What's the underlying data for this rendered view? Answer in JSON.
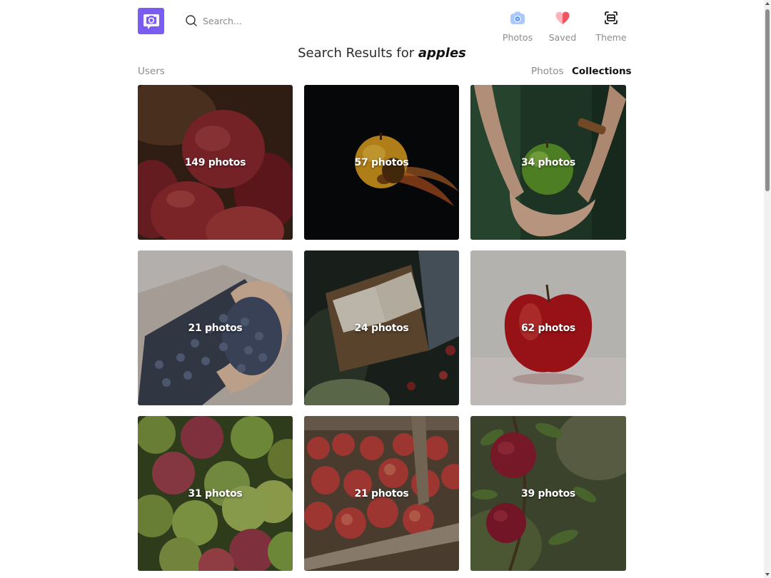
{
  "header": {
    "search_placeholder": "Search...",
    "nav": [
      {
        "label": "Photos",
        "icon": "camera-icon"
      },
      {
        "label": "Saved",
        "icon": "heart-icon"
      },
      {
        "label": "Theme",
        "icon": "theme-icon"
      }
    ]
  },
  "results": {
    "prefix": "Search Results for",
    "query": "apples"
  },
  "tabs": {
    "users": "Users",
    "photos": "Photos",
    "collections": "Collections",
    "active": "Collections"
  },
  "collections": [
    {
      "count": "149 photos",
      "subject": "red apples in basket"
    },
    {
      "count": "57 photos",
      "subject": "burning apple on dark background"
    },
    {
      "count": "34 photos",
      "subject": "green apple held in hands"
    },
    {
      "count": "21 photos",
      "subject": "blueberries in hands"
    },
    {
      "count": "24 photos",
      "subject": "open book with apples"
    },
    {
      "count": "62 photos",
      "subject": "single red apple"
    },
    {
      "count": "31 photos",
      "subject": "pile of green and red apples"
    },
    {
      "count": "21 photos",
      "subject": "apples in wooden crates"
    },
    {
      "count": "39 photos",
      "subject": "apples on tree branch"
    }
  ],
  "colors": {
    "brand": "#7b5cf0",
    "text_muted": "#8c8c8c",
    "text_strong": "#111111"
  }
}
